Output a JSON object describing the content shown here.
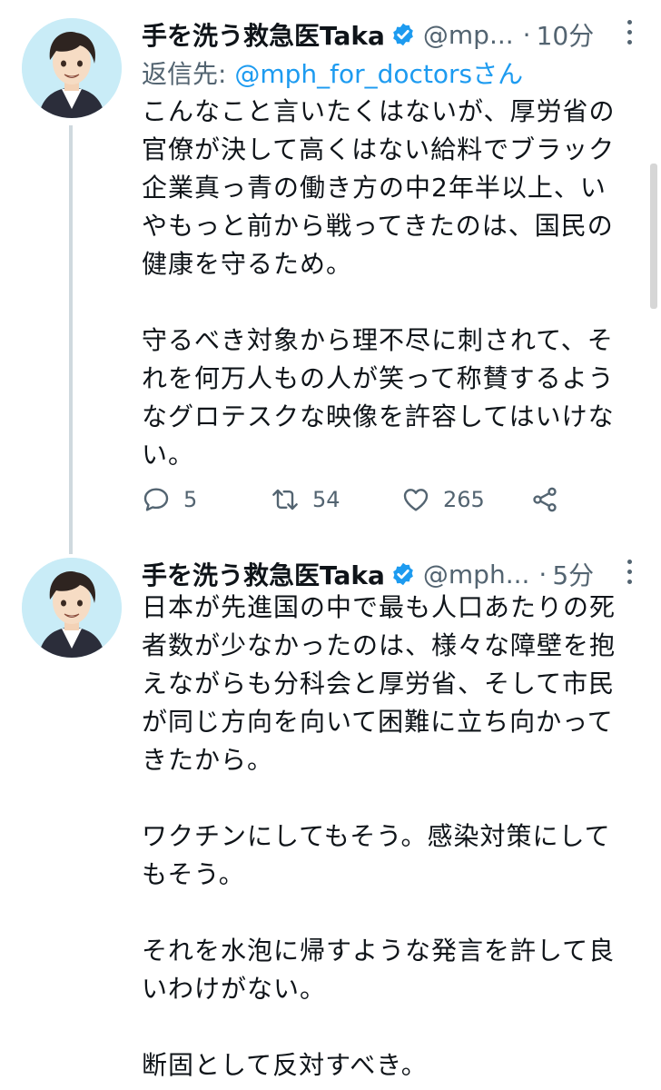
{
  "colors": {
    "text": "#0f1419",
    "secondary": "#536471",
    "link": "#1d9bf0",
    "thread_line": "#cfd9de",
    "verified_badge": "#1d9bf0"
  },
  "tweets": [
    {
      "author_name": "手を洗う救急医Taka",
      "handle": "@mp...",
      "separator": "·",
      "time": "10分",
      "replying_prefix": "返信先: ",
      "replying_handle": "@mph_for_doctorsさん",
      "text": "こんなこと言いたくはないが、厚労省の\n官僚が決して高くはない給料でブラック\n企業真っ青の働き方の中2年半以上、い\nやもっと前から戦ってきたのは、国民の\n健康を守るため。\n\n守るべき対象から理不尽に刺されて、そ\nれを何万人もの人が笑って称賛するよう\nなグロテスクな映像を許容してはいけな\nい。",
      "reply_count": "5",
      "retweet_count": "54",
      "like_count": "265",
      "icons": [
        "verified-badge-icon",
        "more-icon",
        "reply-icon",
        "retweet-icon",
        "like-icon",
        "share-icon"
      ]
    },
    {
      "author_name": "手を洗う救急医Taka",
      "handle": "@mph...",
      "separator": "·",
      "time": "5分",
      "text": "日本が先進国の中で最も人口あたりの死\n者数が少なかったのは、様々な障壁を抱\nえながらも分科会と厚労省、そして市民\nが同じ方向を向いて困難に立ち向かって\nきたから。\n\nワクチンにしてもそう。感染対策にして\nもそう。\n\nそれを水泡に帰すような発言を許して良\nいわけがない。\n\n断固として反対すべき。",
      "icons": [
        "verified-badge-icon",
        "more-icon"
      ]
    }
  ]
}
